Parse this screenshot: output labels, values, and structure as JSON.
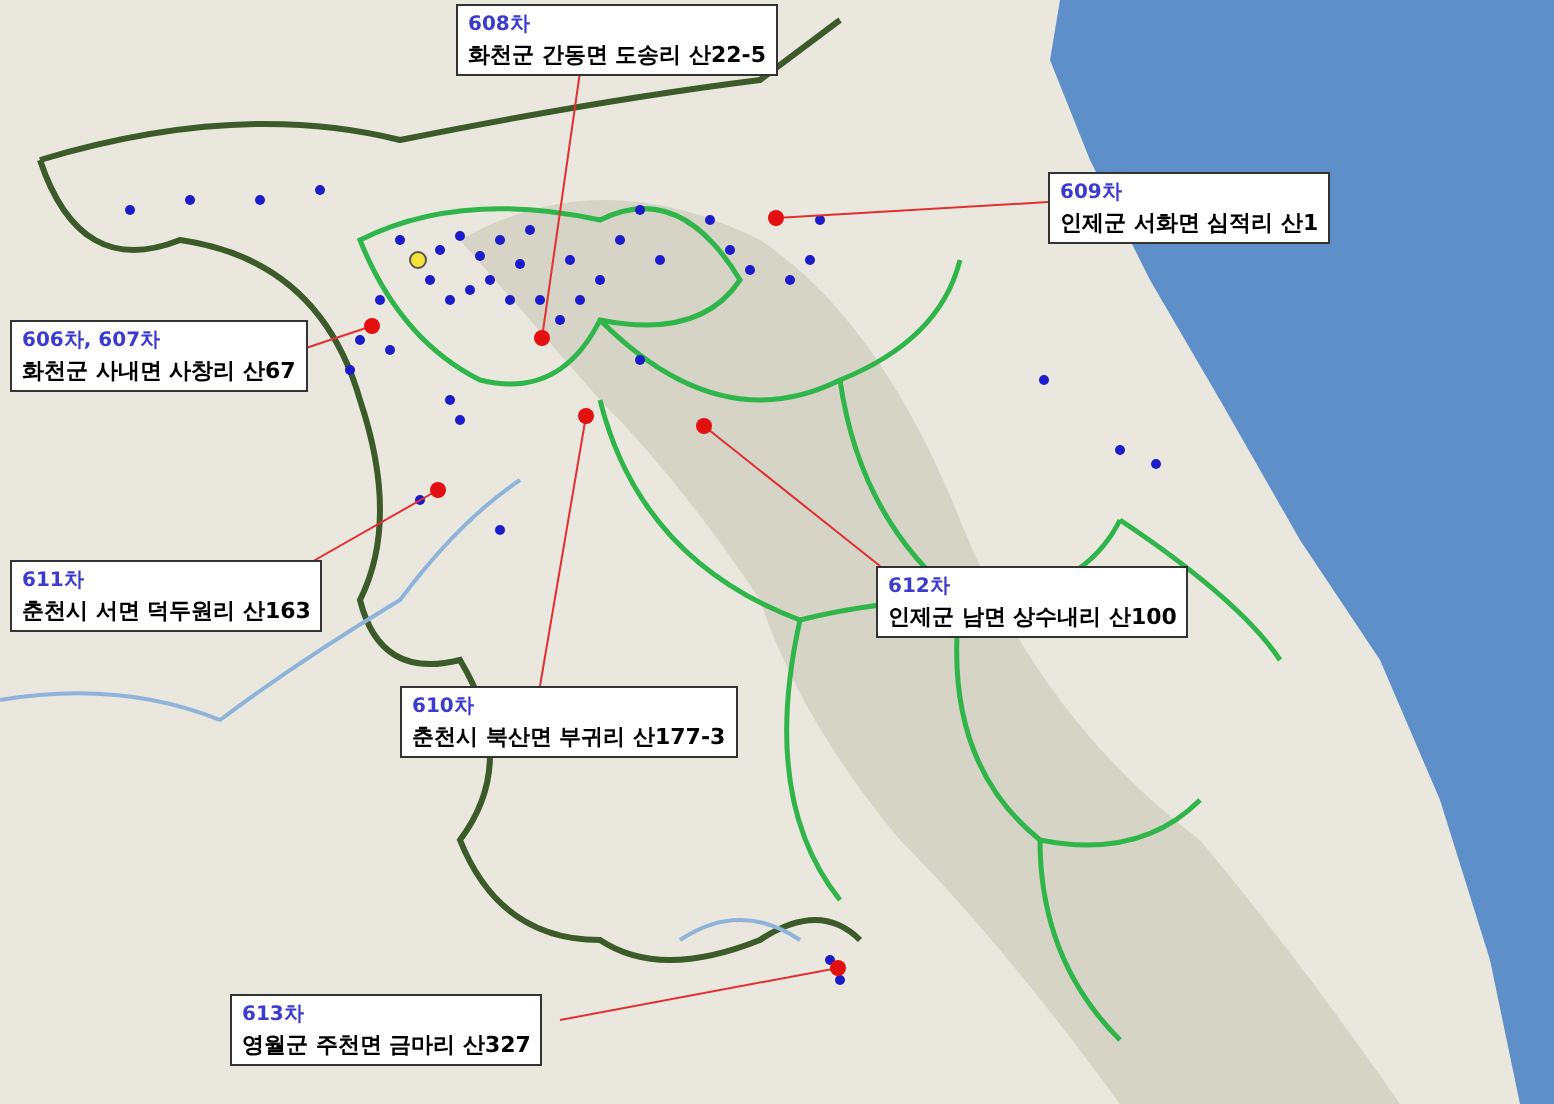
{
  "callouts": [
    {
      "code": "608차",
      "address": "화천군 간동면 도송리 산22-5"
    },
    {
      "code": "609차",
      "address": "인제군 서화면 심적리 산1"
    },
    {
      "code": "606차, 607차",
      "address": "화천군 사내면 사창리 산67"
    },
    {
      "code": "611차",
      "address": "춘천시 서면 덕두원리 산163"
    },
    {
      "code": "612차",
      "address": "인제군 남면 상수내리 산100"
    },
    {
      "code": "610차",
      "address": "춘천시 북산면 부귀리 산177-3"
    },
    {
      "code": "613차",
      "address": "영월군 주천면 금마리 산327"
    }
  ]
}
